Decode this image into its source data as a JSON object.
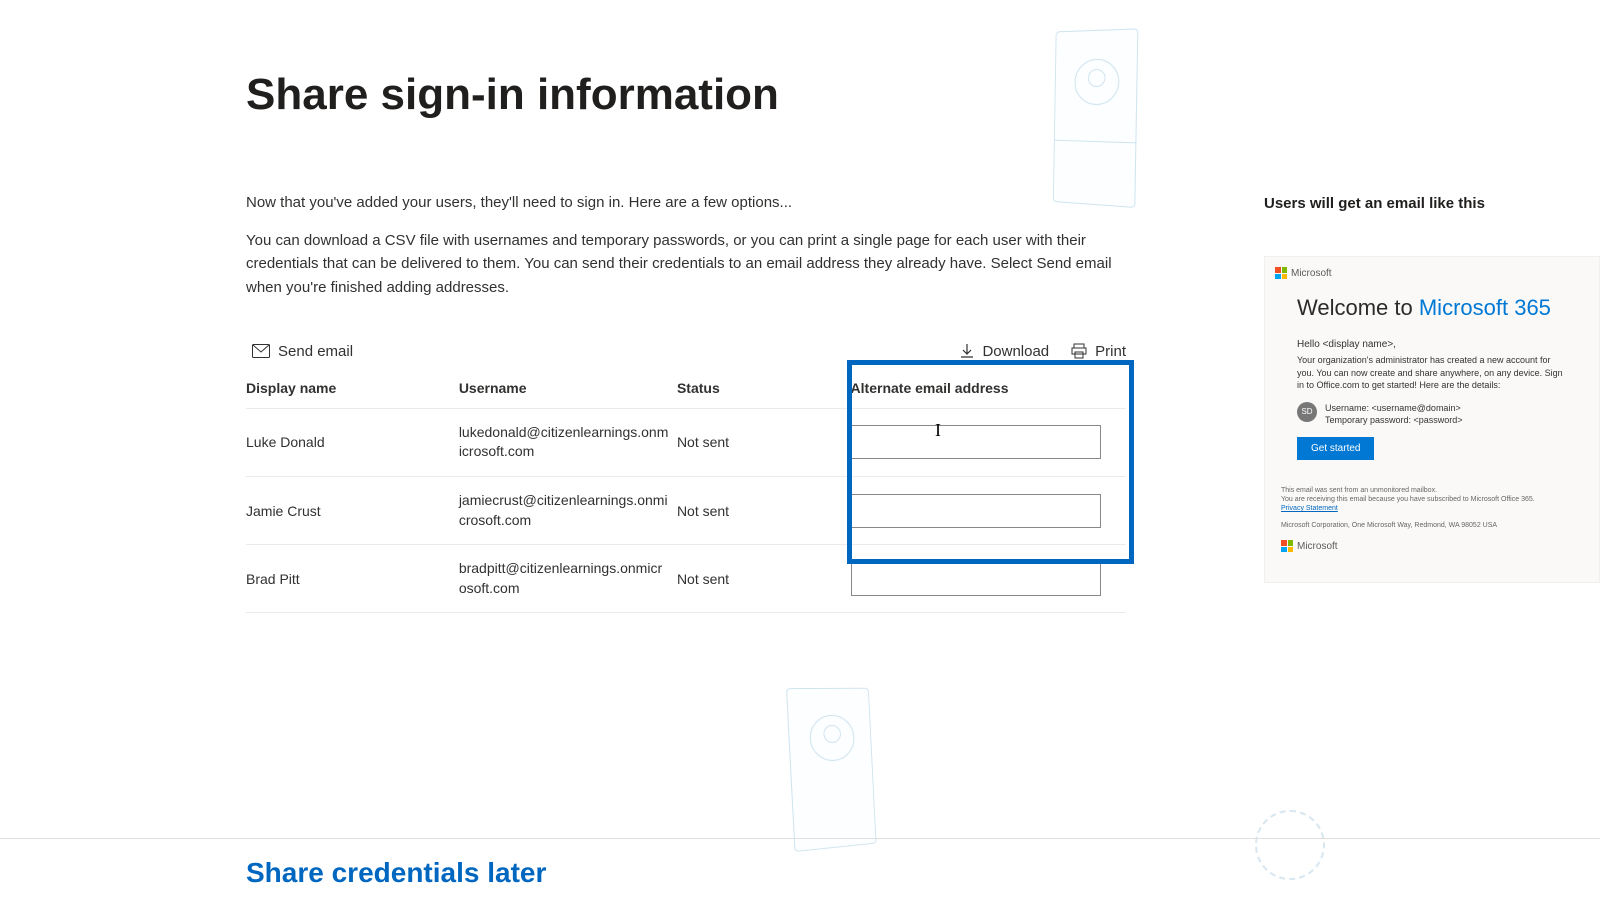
{
  "title": "Share sign-in information",
  "intro": "Now that you've added your users, they'll need to sign in. Here are a few options...",
  "description": "You can download a CSV file with usernames and temporary passwords, or you can print a single page for each user with their credentials that can be delivered to them. You can send their credentials to an email address they already have. Select Send email when you're finished adding addresses.",
  "toolbar": {
    "send_email": "Send email",
    "download": "Download",
    "print": "Print"
  },
  "columns": {
    "display_name": "Display name",
    "username": "Username",
    "status": "Status",
    "alt_email": "Alternate email address"
  },
  "rows": [
    {
      "name": "Luke Donald",
      "username": "lukedonald@citizenlearnings.onmicrosoft.com",
      "status": "Not sent",
      "alt": ""
    },
    {
      "name": "Jamie Crust",
      "username": "jamiecrust@citizenlearnings.onmicrosoft.com",
      "status": "Not sent",
      "alt": ""
    },
    {
      "name": "Brad Pitt",
      "username": "bradpitt@citizenlearnings.onmicrosoft.com",
      "status": "Not sent",
      "alt": ""
    }
  ],
  "preview": {
    "header": "Users will get an email like this",
    "brand": "Microsoft",
    "welcome_prefix": "Welcome to ",
    "welcome_product": "Microsoft 365",
    "hello": "Hello <display name>,",
    "body": "Your organization's administrator has created a new account for you. You can now create and share anywhere, on any device. Sign in to Office.com to get started! Here are the details:",
    "avatar": "SD",
    "cred_user": "Username: <username@domain>",
    "cred_pass": "Temporary password: <password>",
    "cta": "Get started",
    "foot1": "This email was sent from an unmonitored mailbox.",
    "foot2": "You are receiving this email because you have subscribed to Microsoft Office 365.",
    "privacy": "Privacy Statement",
    "foot3": "Microsoft Corporation, One Microsoft Way, Redmond, WA 98052 USA"
  },
  "footer": {
    "share_later": "Share credentials later"
  }
}
